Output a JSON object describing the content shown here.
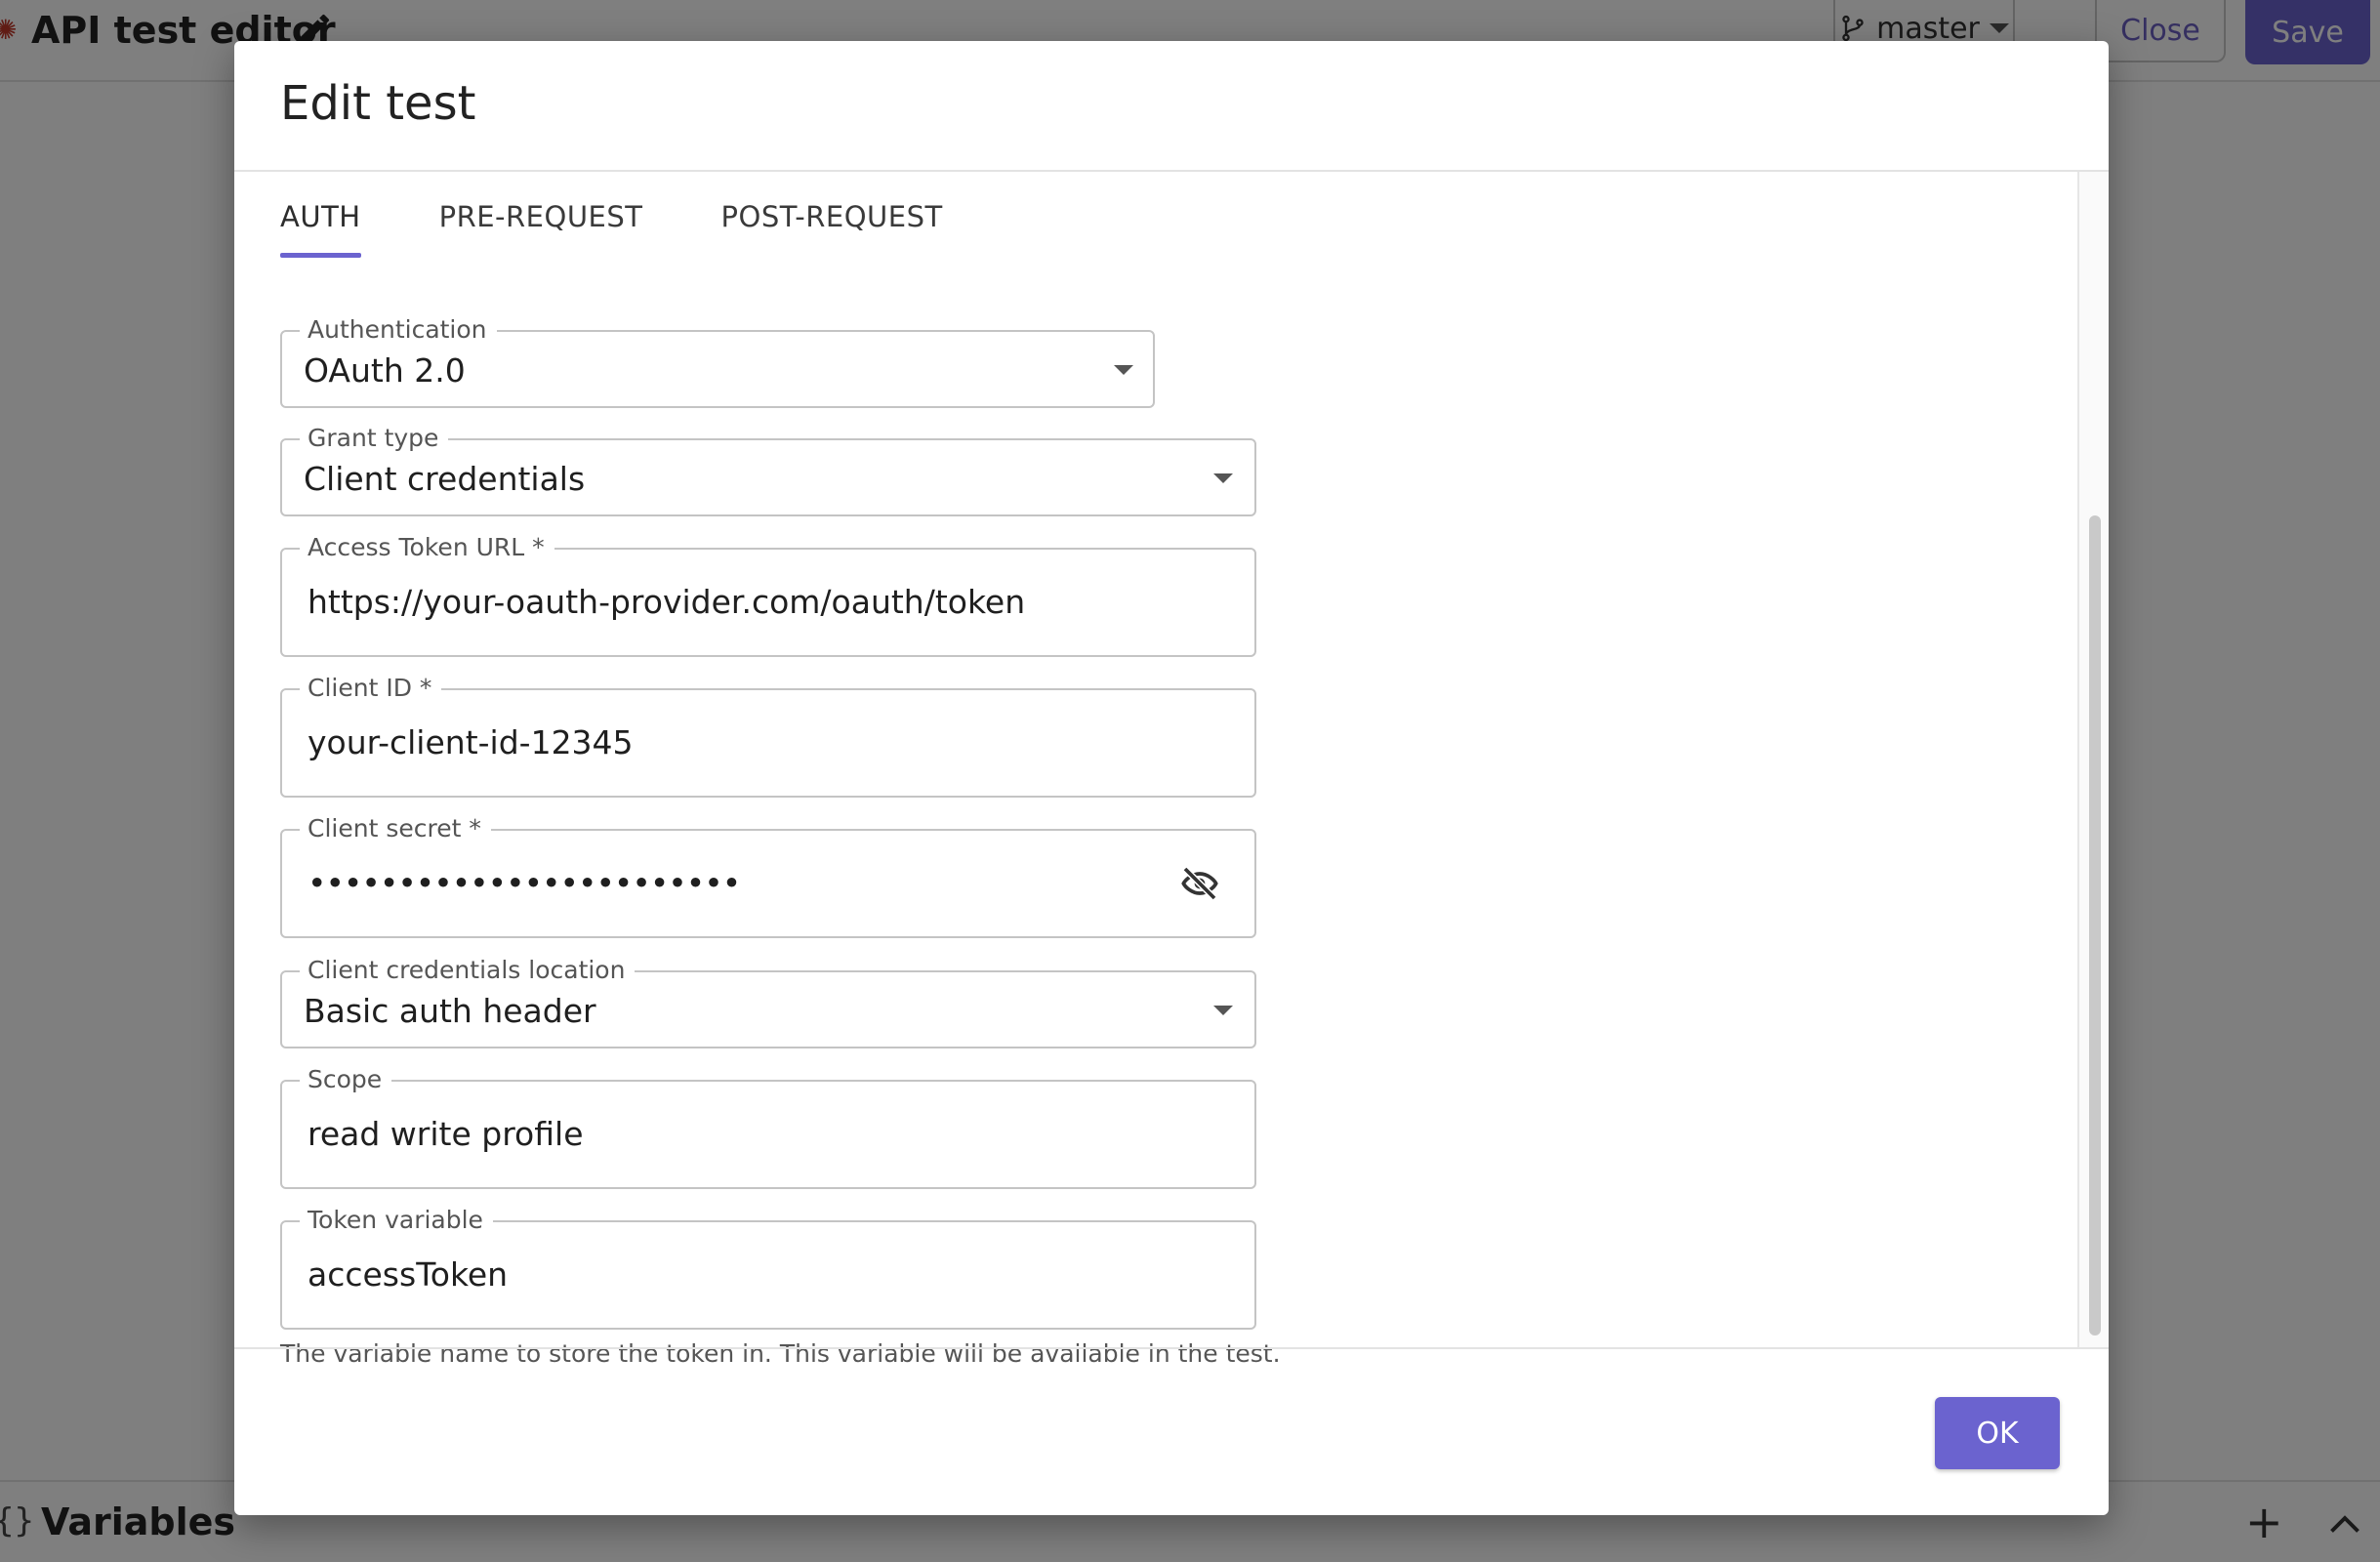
{
  "app": {
    "title": "API test editor",
    "branch": "master",
    "close_label": "Close",
    "save_label": "Save",
    "footer_title": "Variables",
    "footer_add": "+"
  },
  "dialog": {
    "title": "Edit test",
    "tabs": [
      {
        "label": "AUTH",
        "active": true
      },
      {
        "label": "PRE-REQUEST",
        "active": false
      },
      {
        "label": "POST-REQUEST",
        "active": false
      }
    ],
    "fields": {
      "authentication": {
        "label": "Authentication",
        "value": "OAuth 2.0"
      },
      "grant_type": {
        "label": "Grant type",
        "value": "Client credentials"
      },
      "access_token_url": {
        "label": "Access Token URL *",
        "value": "https://your-oauth-provider.com/oauth/token"
      },
      "client_id": {
        "label": "Client ID *",
        "value": "your-client-id-12345"
      },
      "client_secret": {
        "label": "Client secret *",
        "value": "••••••••••••••••••••••••"
      },
      "credentials_location": {
        "label": "Client credentials location",
        "value": "Basic auth header"
      },
      "scope": {
        "label": "Scope",
        "value": "read write profile"
      },
      "token_variable": {
        "label": "Token variable",
        "value": "accessToken"
      }
    },
    "helper_text": "The variable name to store the token in. This variable will be available in the test.",
    "ok_label": "OK"
  },
  "colors": {
    "accent": "#6b63cf",
    "backdrop": "rgba(0,0,0,0.5)"
  },
  "icons": [
    "pencil-icon",
    "git-branch-icon",
    "caret-down-icon",
    "eye-off-icon",
    "plus-icon",
    "chevron-up-icon",
    "braces-icon"
  ]
}
